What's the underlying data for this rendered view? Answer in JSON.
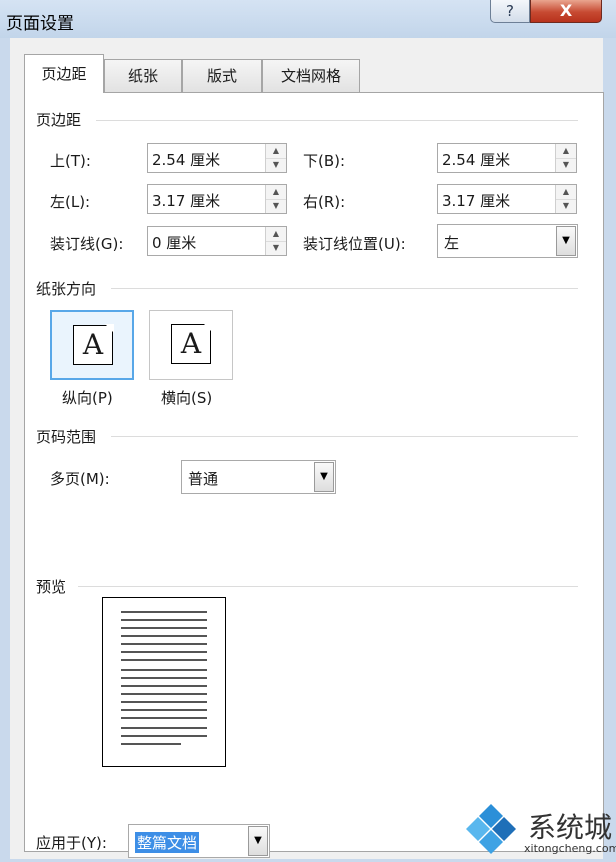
{
  "window": {
    "title": "页面设置",
    "help_label": "?",
    "close_label": "X"
  },
  "tabs": [
    {
      "label": "页边距",
      "active": true
    },
    {
      "label": "纸张",
      "active": false
    },
    {
      "label": "版式",
      "active": false
    },
    {
      "label": "文档网格",
      "active": false
    }
  ],
  "margins": {
    "title": "页边距",
    "top": {
      "label": "上(T):",
      "value": "2.54 厘米"
    },
    "bottom": {
      "label": "下(B):",
      "value": "2.54 厘米"
    },
    "left": {
      "label": "左(L):",
      "value": "3.17 厘米"
    },
    "right": {
      "label": "右(R):",
      "value": "3.17 厘米"
    },
    "gutter": {
      "label": "装订线(G):",
      "value": "0 厘米"
    },
    "gutter_position": {
      "label": "装订线位置(U):",
      "value": "左"
    }
  },
  "orientation": {
    "title": "纸张方向",
    "portrait": {
      "label": "纵向(P)",
      "glyph": "A",
      "selected": true
    },
    "landscape": {
      "label": "横向(S)",
      "glyph": "A",
      "selected": false
    }
  },
  "pages": {
    "title": "页码范围",
    "multiple": {
      "label": "多页(M):",
      "value": "普通"
    }
  },
  "preview": {
    "title": "预览"
  },
  "apply": {
    "label": "应用于(Y):",
    "value": "整篇文档"
  },
  "watermark": {
    "brand": "系统城",
    "url": "xitongcheng.com"
  },
  "colors": {
    "accent": "#3d8ee6",
    "selection_border": "#58a7e8",
    "close": "#c74a32"
  }
}
